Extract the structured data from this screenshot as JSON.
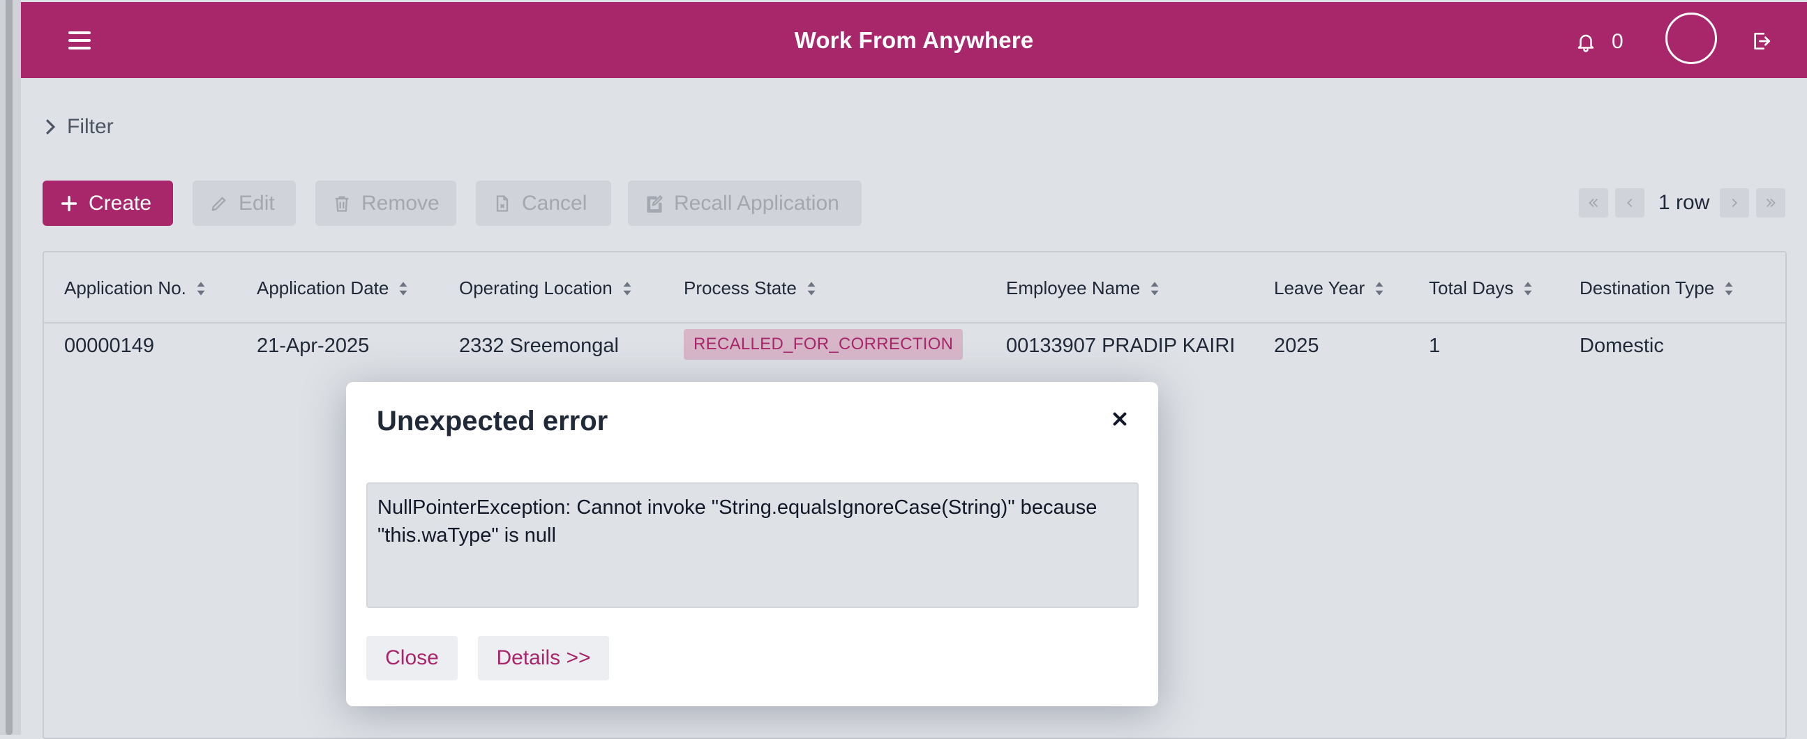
{
  "header": {
    "title": "Work From Anywhere",
    "notification_count": "0",
    "accent_color": "#a8276b"
  },
  "filter": {
    "label": "Filter"
  },
  "toolbar": {
    "create_label": "Create",
    "edit_label": "Edit",
    "remove_label": "Remove",
    "cancel_label": "Cancel",
    "recall_label": "Recall Application"
  },
  "pager": {
    "row_count_label": "1 row"
  },
  "table": {
    "columns": [
      "Application No.",
      "Application Date",
      "Operating Location",
      "Process State",
      "Employee Name",
      "Leave Year",
      "Total Days",
      "Destination Type"
    ],
    "rows": [
      {
        "application_no": "00000149",
        "application_date": "21-Apr-2025",
        "operating_location": "2332 Sreemongal",
        "process_state": "RECALLED_FOR_CORRECTION",
        "employee_name": "00133907 PRADIP KAIRI",
        "leave_year": "2025",
        "total_days": "1",
        "destination_type": "Domestic"
      }
    ]
  },
  "dialog": {
    "title": "Unexpected error",
    "message": "NullPointerException: Cannot invoke \"String.equalsIgnoreCase(String)\" because \"this.waType\" is null",
    "close_label": "Close",
    "details_label": "Details >>"
  }
}
